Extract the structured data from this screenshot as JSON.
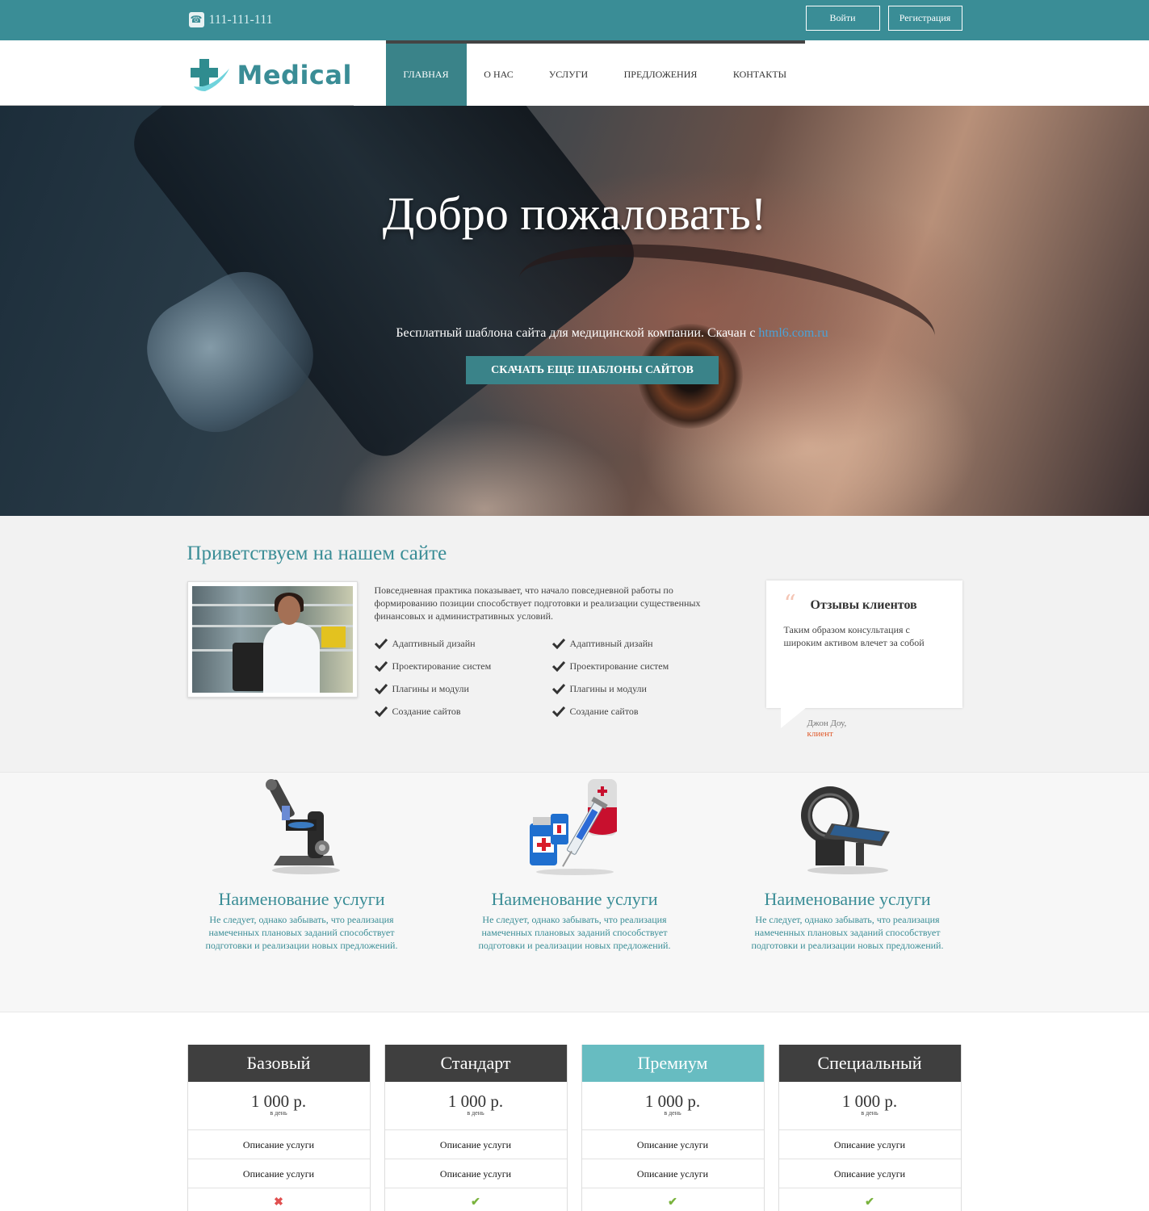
{
  "topbar": {
    "phone": "111-111-111",
    "login_label": "Войти",
    "register_label": "Регистрация"
  },
  "header": {
    "logo_text": "Medical",
    "nav": [
      {
        "label": "ГЛАВНАЯ",
        "active": true
      },
      {
        "label": "О НАС",
        "active": false
      },
      {
        "label": "УСЛУГИ",
        "active": false
      },
      {
        "label": "ПРЕДЛОЖЕНИЯ",
        "active": false
      },
      {
        "label": "КОНТАКТЫ",
        "active": false
      }
    ]
  },
  "hero": {
    "title": "Добро пожаловать!",
    "subtitle_text": "Бесплатный шаблона сайта для медицинской компании. Скачан с ",
    "subtitle_link": "html6.com.ru",
    "button_label": "СКАЧАТЬ ЕЩЕ ШАБЛОНЫ САЙТОВ"
  },
  "welcome": {
    "title": "Приветствуем на нашем сайте",
    "intro": "Повседневная практика показывает, что начало повседневной работы по формированию позиции способствует подготовки и реализации существенных финансовых и административных условий.",
    "checks": [
      "Адаптивный дизайн",
      "Адаптивный дизайн",
      "Проектирование систем",
      "Проектирование систем",
      "Плагины и модули",
      "Плагины и модули",
      "Создание сайтов",
      "Создание сайтов"
    ],
    "review": {
      "title": "Отзывы клиентов",
      "text": "Таким образом консультация с широким активом влечет за собой",
      "author": "Джон Доу,",
      "role": "клиент"
    }
  },
  "services": [
    {
      "icon": "microscope-icon",
      "title": "Наименование услуги",
      "text": "Не следует, однако забывать, что реализация намеченных плановых заданий способствует подготовки и реализации новых предложений."
    },
    {
      "icon": "syringe-medicine-icon",
      "title": "Наименование услуги",
      "text": "Не следует, однако забывать, что реализация намеченных плановых заданий способствует подготовки и реализации новых предложений."
    },
    {
      "icon": "ct-scanner-icon",
      "title": "Наименование услуги",
      "text": "Не следует, однако забывать, что реализация намеченных плановых заданий способствует подготовки и реализации новых предложений."
    }
  ],
  "pricing": [
    {
      "name": "Базовый",
      "price": "1 000 р.",
      "period": "в день",
      "rows": [
        "Описание услуги",
        "Описание услуги"
      ],
      "included": false,
      "featured": false
    },
    {
      "name": "Стандарт",
      "price": "1 000 р.",
      "period": "в день",
      "rows": [
        "Описание услуги",
        "Описание услуги"
      ],
      "included": true,
      "featured": false
    },
    {
      "name": "Премиум",
      "price": "1 000 р.",
      "period": "в день",
      "rows": [
        "Описание услуги",
        "Описание услуги"
      ],
      "included": true,
      "featured": true
    },
    {
      "name": "Специальный",
      "price": "1 000 р.",
      "period": "в день",
      "rows": [
        "Описание услуги",
        "Описание услуги"
      ],
      "included": true,
      "featured": false
    }
  ],
  "colors": {
    "brand": "#3a8d96",
    "nav_active": "#3a8389",
    "featured_plan": "#67bcc1",
    "plan_header": "#3f3f3f",
    "accent_role": "#e05a2b"
  }
}
